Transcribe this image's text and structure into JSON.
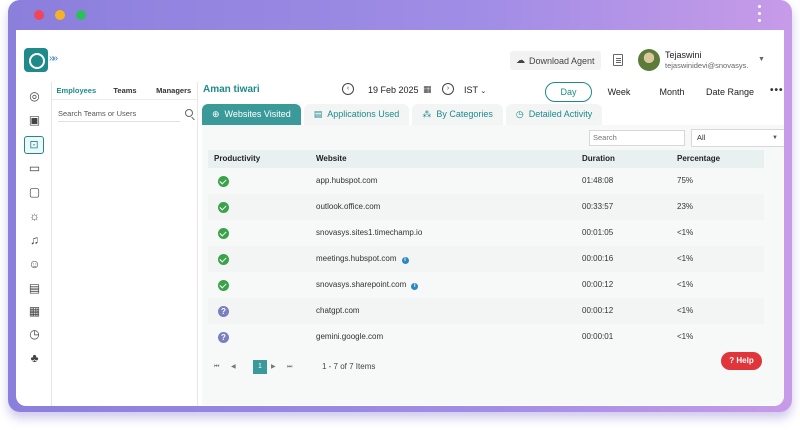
{
  "header": {
    "download_agent": "Download Agent",
    "user_name": "Tejaswini",
    "user_email": "tejaswinidevi@snovasys..."
  },
  "panel": {
    "tabs": [
      "Employees",
      "Teams",
      "Managers"
    ],
    "search_placeholder": "Search Teams or Users"
  },
  "toolbar": {
    "employee": "Aman tiwari",
    "date": "19 Feb 2025",
    "timezone": "IST",
    "ranges": [
      "Day",
      "Week",
      "Month",
      "Date Range"
    ]
  },
  "tabs": [
    "Websites Visited",
    "Applications Used",
    "By Categories",
    "Detailed Activity"
  ],
  "filters": {
    "search_placeholder": "Search",
    "select_value": "All"
  },
  "table": {
    "headers": [
      "Productivity",
      "Website",
      "Duration",
      "Percentage"
    ],
    "rows": [
      {
        "status": "productive",
        "website": "app.hubspot.com",
        "info": false,
        "duration": "01:48:08",
        "percentage": "75%"
      },
      {
        "status": "productive",
        "website": "outlook.office.com",
        "info": false,
        "duration": "00:33:57",
        "percentage": "23%"
      },
      {
        "status": "productive",
        "website": "snovasys.sites1.timechamp.io",
        "info": false,
        "duration": "00:01:05",
        "percentage": "<1%"
      },
      {
        "status": "productive",
        "website": "meetings.hubspot.com",
        "info": true,
        "duration": "00:00:16",
        "percentage": "<1%"
      },
      {
        "status": "productive",
        "website": "snovasys.sharepoint.com",
        "info": true,
        "duration": "00:00:12",
        "percentage": "<1%"
      },
      {
        "status": "unknown",
        "website": "chatgpt.com",
        "info": false,
        "duration": "00:00:12",
        "percentage": "<1%"
      },
      {
        "status": "unknown",
        "website": "gemini.google.com",
        "info": false,
        "duration": "00:00:01",
        "percentage": "<1%"
      }
    ]
  },
  "pager": {
    "current": "1",
    "count": "1 - 7 of 7 Items"
  },
  "help": "Help",
  "colors": {
    "accent": "#1f8a8a",
    "productive": "#3aa34a",
    "unknown": "#7a7fc0",
    "help": "#e0353b"
  }
}
